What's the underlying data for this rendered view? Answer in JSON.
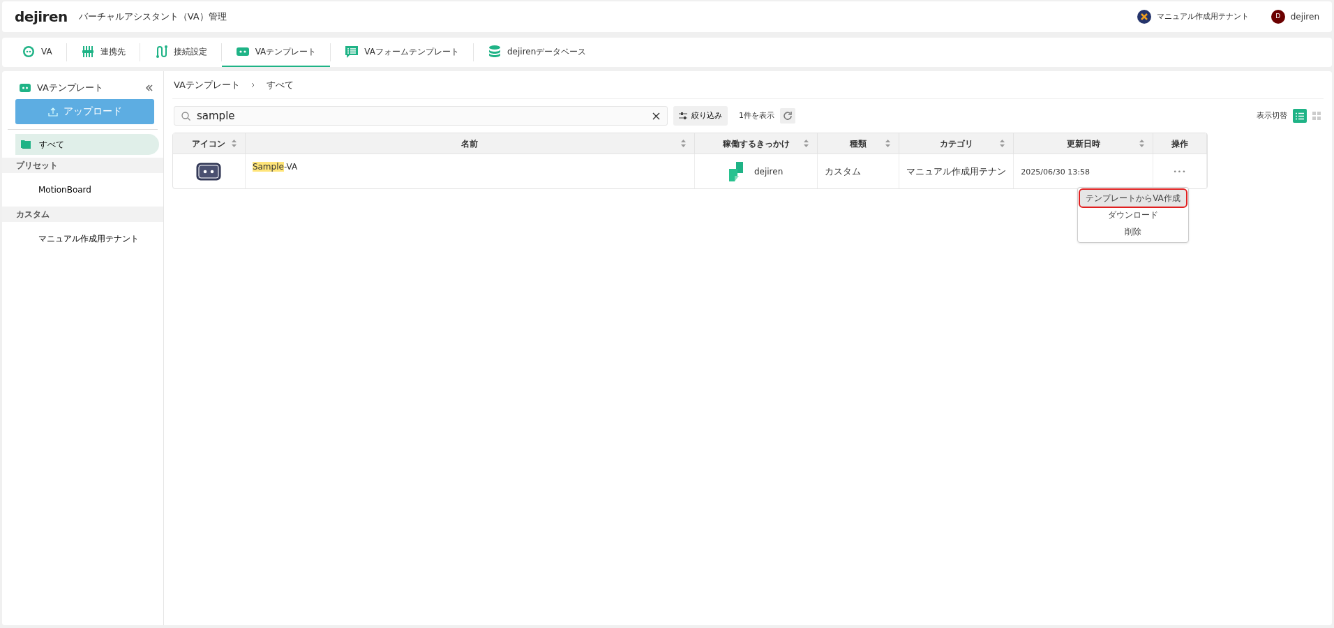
{
  "header": {
    "logo": "dejiren",
    "title": "バーチャルアシスタント（VA）管理",
    "tenant": "マニュアル作成用テナント",
    "user_initial": "D",
    "user": "dejiren"
  },
  "tabs": [
    {
      "label": "VA",
      "selected": false
    },
    {
      "label": "連携先",
      "selected": false
    },
    {
      "label": "接続設定",
      "selected": false
    },
    {
      "label": "VAテンプレート",
      "selected": true
    },
    {
      "label": "VAフォームテンプレート",
      "selected": false
    },
    {
      "label": "dejirenデータベース",
      "selected": false
    }
  ],
  "sidebar": {
    "title": "VAテンプレート",
    "upload": "アップロード",
    "items": [
      {
        "kind": "item",
        "label": "すべて",
        "selected": true
      },
      {
        "kind": "group",
        "label": "プリセット"
      },
      {
        "kind": "item",
        "label": "MotionBoard",
        "selected": false
      },
      {
        "kind": "group",
        "label": "カスタム"
      },
      {
        "kind": "item",
        "label": "マニュアル作成用テナント",
        "selected": false
      }
    ]
  },
  "breadcrumb": [
    "VAテンプレート",
    "すべて"
  ],
  "search": {
    "value": "sample"
  },
  "filter_button": "絞り込み",
  "count": "1件を表示",
  "view_switch": {
    "label": "表示切替",
    "options": [
      {
        "kind": "list",
        "selected": true
      },
      {
        "kind": "grid",
        "selected": false
      }
    ]
  },
  "table": {
    "columns": [
      "アイコン",
      "名前",
      "稼働するきっかけ",
      "種類",
      "カテゴリ",
      "更新日時",
      "操作"
    ],
    "rows": [
      {
        "name_match": "Sample",
        "name_rest": "-VA",
        "trigger": "dejiren",
        "type": "カスタム",
        "category": "マニュアル作成用テナン",
        "updated": "2025/06/30 13:58",
        "actions": "•••"
      }
    ]
  },
  "menu": [
    {
      "label": "テンプレートからVA作成",
      "selected": true
    },
    {
      "label": "ダウンロード",
      "selected": false
    },
    {
      "label": "削除",
      "selected": false
    }
  ]
}
